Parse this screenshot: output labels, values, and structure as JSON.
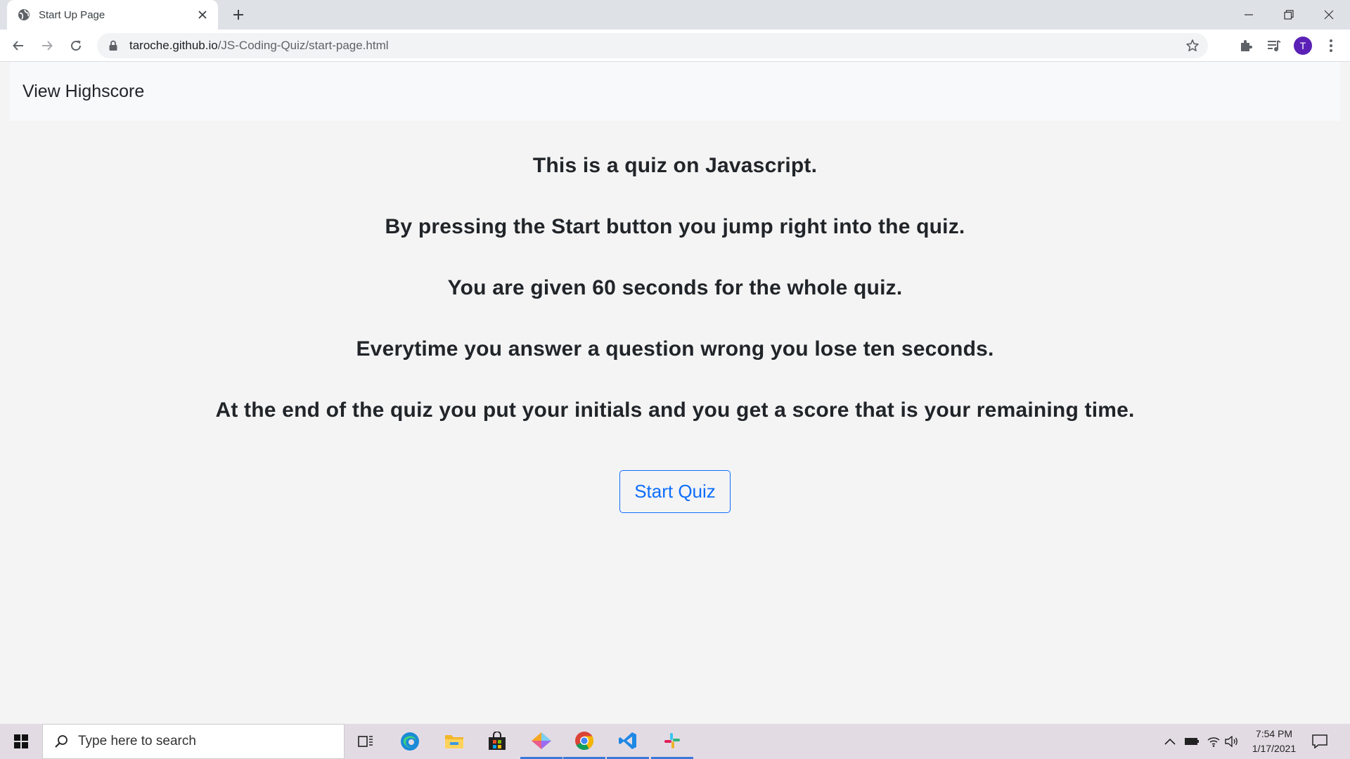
{
  "browser": {
    "tab_title": "Start Up Page",
    "url_host": "taroche.github.io",
    "url_path": "/JS-Coding-Quiz/start-page.html",
    "profile_initial": "T",
    "icons": [
      "globe-icon",
      "close-icon",
      "plus-icon",
      "back-icon",
      "forward-icon",
      "reload-icon",
      "lock-icon",
      "star-icon",
      "extensions-icon",
      "media-icon",
      "menu-icon"
    ]
  },
  "page": {
    "nav_link": "View Highscore",
    "intro": [
      "This is a quiz on Javascript.",
      "By pressing the Start button you jump right into the quiz.",
      "You are given 60 seconds for the whole quiz.",
      "Everytime you answer a question wrong you lose ten seconds.",
      "At the end of the quiz you put your initials and you get a score that is your remaining time."
    ],
    "start_button": "Start Quiz",
    "button_color": "#0d6efd"
  },
  "taskbar": {
    "search_placeholder": "Type here to search",
    "time": "7:54 PM",
    "date": "1/17/2021",
    "apps": [
      "task-view-icon",
      "edge-icon",
      "file-explorer-icon",
      "store-icon",
      "app-icon",
      "chrome-icon",
      "vscode-icon",
      "slack-icon"
    ]
  }
}
